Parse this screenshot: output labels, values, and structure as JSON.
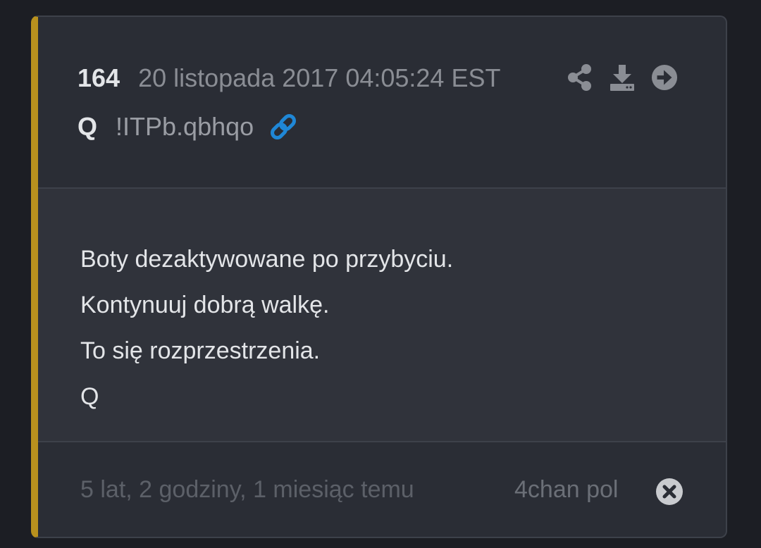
{
  "post": {
    "number": "164",
    "date": "20 listopada 2017 04:05:24 EST",
    "author": "Q",
    "tripcode": "!ITPb.qbhqo",
    "body_lines": [
      "Boty dezaktywowane po przybyciu.",
      "Kontynuuj dobrą walkę.",
      "To się rozprzestrzenia.",
      "Q"
    ],
    "time_ago": "5 lat, 2 godziny, 1 miesiąc temu",
    "source": "4chan pol"
  },
  "icons": {
    "share": "share-icon",
    "download": "download-icon",
    "navigate": "arrow-circle-right-icon",
    "link": "link-icon",
    "close": "close-circle-icon"
  },
  "colors": {
    "accent_bar": "#b8911e",
    "link": "#1f87d6",
    "background": "#1c1e24",
    "card": "#2a2d35",
    "body": "#30333b"
  }
}
